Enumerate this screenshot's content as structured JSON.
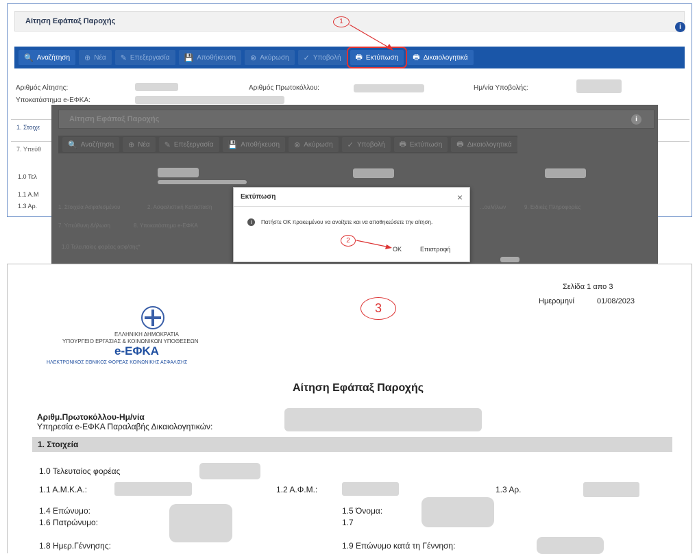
{
  "window": {
    "title": "Αίτηση Εφάπαξ Παροχής",
    "toolbar": [
      {
        "label": "Αναζήτηση",
        "icon": "search-icon",
        "glyph": "🔍"
      },
      {
        "label": "Νέα",
        "icon": "plus-circle-icon",
        "glyph": "⊕"
      },
      {
        "label": "Επεξεργασία",
        "icon": "pencil-icon",
        "glyph": "✎"
      },
      {
        "label": "Αποθήκευση",
        "icon": "floppy-icon",
        "glyph": "💾"
      },
      {
        "label": "Ακύρωση",
        "icon": "cancel-icon",
        "glyph": "⊗"
      },
      {
        "label": "Υποβολή",
        "icon": "check-icon",
        "glyph": "✓"
      },
      {
        "label": "Εκτύπωση",
        "icon": "printer-icon",
        "glyph": "🖶"
      },
      {
        "label": "Δικαιολογητικά",
        "icon": "printer-icon",
        "glyph": "🖶"
      }
    ],
    "fields": {
      "request_no": "Αριθμός Αίτησης:",
      "protocol_no": "Αριθμός Πρωτοκόλλου:",
      "submit_date": "Ημ/νία Υποβολής:",
      "branch": "Υποκατάστημα e-ΕΦΚΑ:"
    },
    "tab_1": "1. Στοιχε",
    "tab_7": "7. Υπεύθ",
    "sec_10": "1.0 Τελ",
    "sec_11": "1.1 Α.Μ",
    "sec_13": "1.3 Αρ."
  },
  "overlay": {
    "title": "Αίτηση Εφάπαξ Παροχής",
    "tabs": [
      "1. Στοιχεία Ασφαλισμένου",
      "2. Ασφαλιστική Κατάσταση",
      "7. Υπεύθυνη Δήλωση",
      "8. Υποκατάστημα e-ΕΦΚΑ",
      "...ουλήλων",
      "9. Ειδικές Πληροφορίες"
    ],
    "field_10": "1.0 Τελευταίος φορέας ασφ/σης*"
  },
  "dialog": {
    "title": "Εκτύπωση",
    "close": "×",
    "message": "Πατήστε ΟΚ προκειμένου να ανοίξετε και να αποθηκεύσετε την αίτηση.",
    "ok": "OK",
    "back": "Επιστροφή"
  },
  "callouts": {
    "one": "1",
    "two": "2",
    "three": "3"
  },
  "document": {
    "page": "Σελίδα 1 απο 3",
    "date_label": "Ημερομηνί",
    "date_value": "01/08/2023",
    "org1": "ΕΛΛΗΝΙΚΗ ΔΗΜΟΚΡΑΤΙΑ",
    "org2": "ΥΠΟΥΡΓΕΙΟ ΕΡΓΑΣΙΑΣ & ΚΟΙΝΩΝΙΚΩΝ ΥΠΟΘΕΣΕΩΝ",
    "brand": "e-ΕΦΚΑ",
    "brand_sub": "ΗΛΕΚΤΡΟΝΙΚΟΣ ΕΘΝΙΚΟΣ ΦΟΡΕΑΣ ΚΟΙΝΩΝΙΚΗΣ ΑΣΦΑΛΙΣΗΣ",
    "title": "Αίτηση Εφάπαξ Παροχής",
    "protocol": "Αριθμ.Πρωτοκόλλου-Ημ/νία",
    "service": "Υπηρεσία e-ΕΦΚΑ Παραλαβής Δικαιολογητικών:",
    "section": "1. Στοιχεία",
    "f10": "1.0  Τελευταίος φορέας",
    "f11": "1.1 Α.Μ.Κ.Α.:",
    "f12": "1.2 Α.Φ.Μ.:",
    "f13": "1.3 Αρ.",
    "f14": "1.4 Επώνυμο:",
    "f15": "1.5 Όνομα:",
    "f16": "1.6 Πατρώνυμο:",
    "f17": "1.7",
    "f18": "1.8 Ημερ.Γέννησης:",
    "f19": "1.9 Επώνυμο κατά τη Γέννηση:"
  },
  "colors": {
    "toolbar": "#1a56a8",
    "highlight": "#d33",
    "redaction": "#d8d8d8"
  }
}
